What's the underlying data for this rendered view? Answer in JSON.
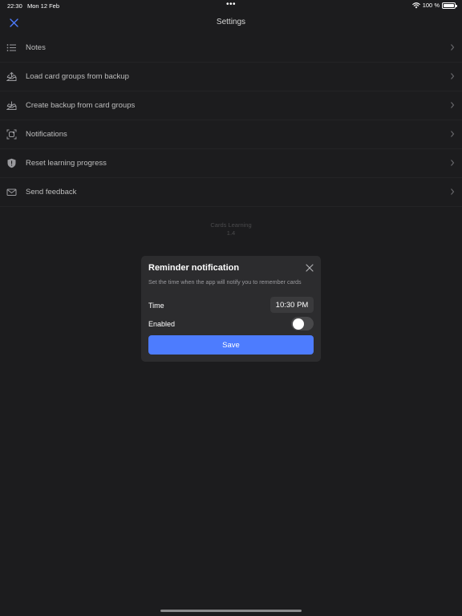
{
  "status_bar": {
    "time": "22:30",
    "date": "Mon 12 Feb",
    "battery": "100 %",
    "dots": "•••"
  },
  "header": {
    "title": "Settings",
    "close_icon": "close-icon"
  },
  "settings": {
    "items": [
      {
        "label": "Notes",
        "icon": "list-icon"
      },
      {
        "label": "Load card groups from backup",
        "icon": "tray-upload-icon"
      },
      {
        "label": "Create backup from card groups",
        "icon": "tray-download-icon"
      },
      {
        "label": "Notifications",
        "icon": "notification-badge-icon"
      },
      {
        "label": "Reset learning progress",
        "icon": "shield-icon"
      },
      {
        "label": "Send feedback",
        "icon": "envelope-icon"
      }
    ]
  },
  "app_info": {
    "name": "Cards Learning",
    "version": "1.4"
  },
  "modal": {
    "title": "Reminder notification",
    "description": "Set the time when the app will notify you to remember cards",
    "time_label": "Time",
    "time_value": "10:30 PM",
    "enabled_label": "Enabled",
    "enabled": false,
    "save_label": "Save"
  },
  "colors": {
    "background": "#1c1c1e",
    "modal_background": "#2c2c2e",
    "accent": "#4d7cfe"
  }
}
